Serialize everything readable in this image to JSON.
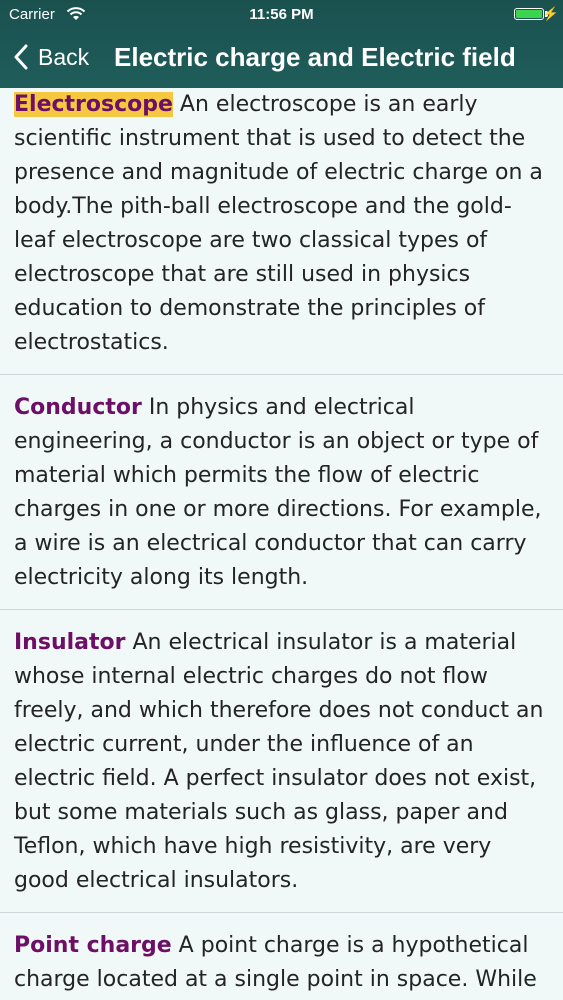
{
  "status_bar": {
    "carrier": "Carrier",
    "time": "11:56 PM",
    "battery_level": 1.0,
    "battery_color": "#3bd54d"
  },
  "nav": {
    "back_label": "Back",
    "title": "Electric charge and Electric field",
    "bar_color": "#1f5d5b"
  },
  "colors": {
    "term": "#6d0f66",
    "highlight": "#f6c842",
    "background": "#f1f8f8"
  },
  "entries": [
    {
      "term": "Electroscope",
      "text": " An electroscope is an early scientific instrument that is used to detect the presence and magnitude of electric charge on a body.The pith-ball electroscope and the gold-leaf electroscope are two classical types of electroscope that are still used in physics education to demonstrate the principles of electrostatics."
    },
    {
      "term": "Conductor",
      "text": " In physics and electrical engineering, a conductor is an object or type of material which permits the flow of electric charges in one or more directions. For example, a wire is an electrical conductor that can carry electricity along its length."
    },
    {
      "term": "Insulator",
      "text": " An electrical insulator is a material whose internal electric charges do not flow freely, and which therefore does not conduct an electric current, under the influence of an electric field. A perfect insulator does not exist, but some materials such as glass, paper and Teflon, which have high resistivity, are very good electrical insulators."
    },
    {
      "term": "Point charge",
      "text": " A point charge is a hypothetical charge located at a single point in space. While an electron can for many purposes be"
    }
  ]
}
